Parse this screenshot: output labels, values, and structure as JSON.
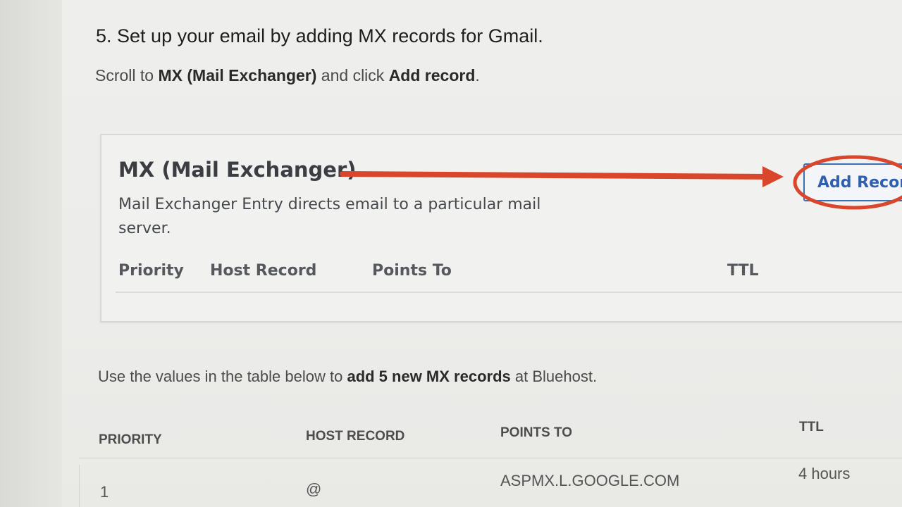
{
  "step": {
    "title": "5. Set up your email by adding MX records for Gmail.",
    "subtitle_pre": "Scroll to ",
    "subtitle_bold1": "MX (Mail Exchanger)",
    "subtitle_mid": " and click ",
    "subtitle_bold2": "Add record",
    "subtitle_post": "."
  },
  "mx_card": {
    "title": "MX (Mail Exchanger)",
    "description": "Mail Exchanger Entry directs email to a particular mail server.",
    "add_button_label": "Add Record",
    "columns": [
      "Priority",
      "Host Record",
      "Points To",
      "TTL"
    ]
  },
  "values_intro": {
    "pre": "Use the values in the table below to ",
    "bold": "add 5 new MX records",
    "post": " at Bluehost."
  },
  "records_table": {
    "headers": [
      "PRIORITY",
      "HOST RECORD",
      "POINTS TO",
      "TTL"
    ],
    "rows": [
      [
        "1",
        "@",
        "ASPMX.L.GOOGLE.COM",
        "4 hours"
      ]
    ]
  },
  "colors": {
    "annotation_red": "#d9462b",
    "button_blue": "#2f5fae"
  },
  "icons": [
    "annotation-arrow-icon",
    "annotation-circle-icon"
  ]
}
